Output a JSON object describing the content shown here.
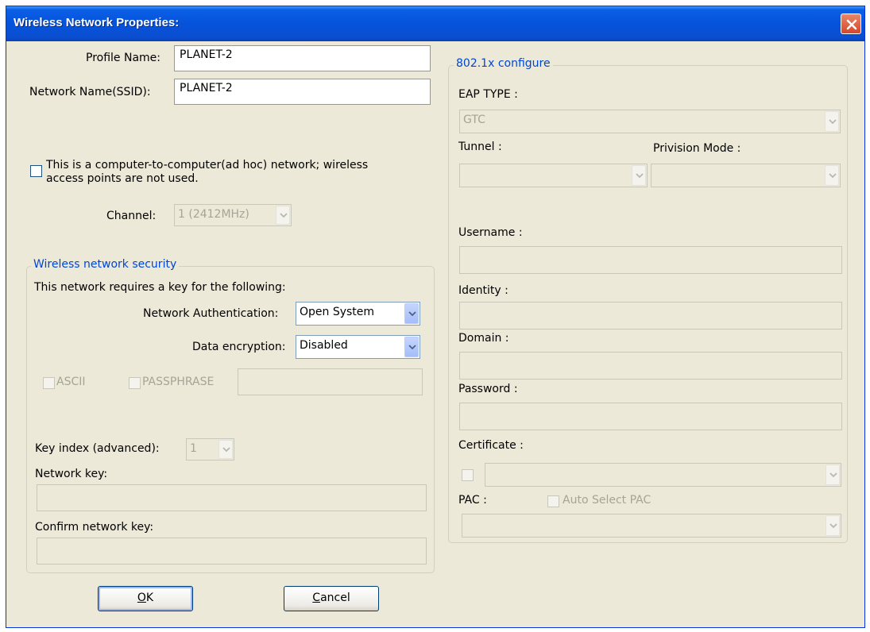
{
  "window": {
    "title": "Wireless Network Properties:"
  },
  "profile": {
    "profile_name_label": "Profile Name:",
    "profile_name_value": "PLANET-2",
    "ssid_label": "Network Name(SSID):",
    "ssid_value": "PLANET-2",
    "adhoc_text_line1": "This is a computer-to-computer(ad hoc) network; wireless",
    "adhoc_text_line2": "access points are not used.",
    "adhoc_checked": false,
    "channel_label": "Channel:",
    "channel_value": "1  (2412MHz)"
  },
  "security": {
    "group_title": "Wireless network security",
    "requires_key_text": "This network requires a key for the following:",
    "auth_label": "Network Authentication:",
    "auth_value": "Open System",
    "encryption_label": "Data encryption:",
    "encryption_value": "Disabled",
    "ascii_label": "ASCII",
    "passphrase_label": "PASSPHRASE",
    "key_index_label": "Key index (advanced):",
    "key_index_value": "1",
    "network_key_label": "Network key:",
    "confirm_key_label": "Confirm network key:"
  },
  "eap": {
    "group_title": "802.1x configure",
    "eap_type_label": "EAP TYPE :",
    "eap_type_value": "GTC",
    "tunnel_label": "Tunnel :",
    "provision_label": "Privision Mode :",
    "username_label": "Username :",
    "identity_label": "Identity :",
    "domain_label": "Domain :",
    "password_label": "Password :",
    "certificate_label": "Certificate :",
    "pac_label": "PAC :",
    "auto_select_pac_label": "Auto Select PAC"
  },
  "buttons": {
    "ok_prefix": "",
    "ok_accel": "O",
    "ok_rest": "K",
    "cancel_accel": "C",
    "cancel_rest": "ancel"
  },
  "icons": {
    "close": "close-icon",
    "dropdown": "chevron-down-icon"
  },
  "colors": {
    "titlebar": "#0553da",
    "dialog_bg": "#ece9d8",
    "group_title": "#0046d5",
    "close": "#d5472a"
  }
}
